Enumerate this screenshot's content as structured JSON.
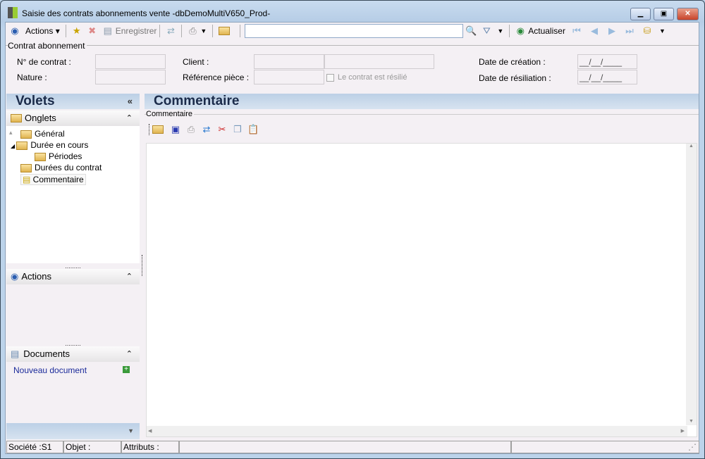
{
  "window": {
    "title": "Saisie des contrats abonnements vente -dbDemoMultiV650_Prod-"
  },
  "toolbar": {
    "actions": "Actions",
    "save": "Enregistrer",
    "search_value": "",
    "refresh": "Actualiser"
  },
  "form": {
    "group": "Contrat abonnement",
    "contract_no_label": "N° de contrat :",
    "nature_label": "Nature :",
    "client_label": "Client :",
    "ref_label": "Référence pièce :",
    "resilie_label": "Le contrat  est résilié",
    "creation_label": "Date de création :",
    "creation_value": "__/__/____",
    "resiliation_label": "Date de résiliation :",
    "resiliation_value": "__/__/____"
  },
  "left": {
    "title": "Volets",
    "onglets": "Onglets",
    "tree": [
      "Général",
      "Durée en cours",
      "Périodes",
      "Durées du contrat",
      "Commentaire"
    ],
    "actions": "Actions",
    "documents": "Documents",
    "new_doc": "Nouveau document"
  },
  "main": {
    "title": "Commentaire",
    "group": "Commentaire"
  },
  "status": {
    "societe": "Société :S1",
    "objet": "Objet :",
    "attributs": "Attributs :"
  }
}
